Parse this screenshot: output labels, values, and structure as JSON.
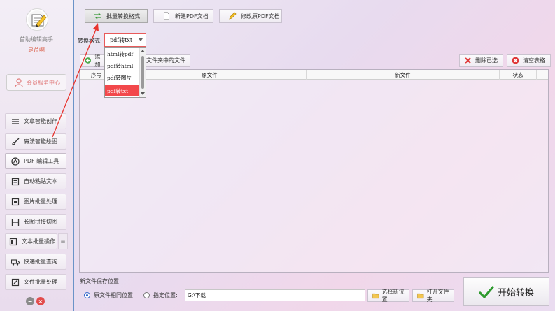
{
  "sidebar": {
    "app_name": "首助编辑高手",
    "user_name": "是芹啊",
    "member_label": "会员服务中心",
    "items": [
      {
        "label": "文章智能创作"
      },
      {
        "label": "魔法智能绘图"
      },
      {
        "label": "PDF 编辑工具"
      },
      {
        "label": "自动粘贴文本"
      },
      {
        "label": "图片批量处理"
      },
      {
        "label": "长图拼接切图"
      },
      {
        "label": "文本批量操作"
      },
      {
        "label": "快递批量查询"
      },
      {
        "label": "文件批量处理"
      }
    ]
  },
  "toolbar": {
    "tabs": [
      {
        "label": "批量转换格式"
      },
      {
        "label": "新建PDF文档"
      },
      {
        "label": "修改原PDF文档"
      }
    ]
  },
  "format": {
    "label": "转换格式:",
    "selected": "pdf转txt",
    "options": [
      "html转pdf",
      "pdf转html",
      "pdf转图片",
      "pdf转txt"
    ]
  },
  "actions": {
    "add_files_partial": "添加",
    "add_folder_partial": "文件夹中的文件",
    "delete_selected": "删除已选",
    "clear_table": "清空表格"
  },
  "table": {
    "columns": [
      "序号",
      "原文件",
      "新文件",
      "状态"
    ]
  },
  "save": {
    "title": "新文件保存位置",
    "option_same": "原文件相同位置",
    "option_custom": "指定位置:",
    "path": "G:\\下载",
    "choose_location": "选择新位置",
    "open_folder": "打开文件夹"
  },
  "start_label": "开始转换",
  "colors": {
    "accent_red": "#f2484b",
    "sidebar_border": "#6a93c8",
    "annotation_arrow": "#e8342e"
  },
  "icons": {
    "logo": "pencil-document-icon",
    "start": "checkmark-icon",
    "delete": "red-x-icon",
    "clear": "red-circle-x-icon"
  }
}
